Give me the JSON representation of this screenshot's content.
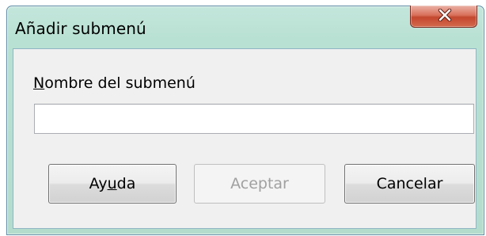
{
  "window": {
    "title": "Añadir submenú"
  },
  "form": {
    "label_prefix": "",
    "label_mnemonic": "N",
    "label_rest": "ombre del submenú",
    "input_value": ""
  },
  "buttons": {
    "help_prefix": "Ay",
    "help_mnemonic": "u",
    "help_rest": "da",
    "ok_label": "Aceptar",
    "cancel_label": "Cancelar"
  },
  "icons": {
    "close": "close-icon"
  }
}
